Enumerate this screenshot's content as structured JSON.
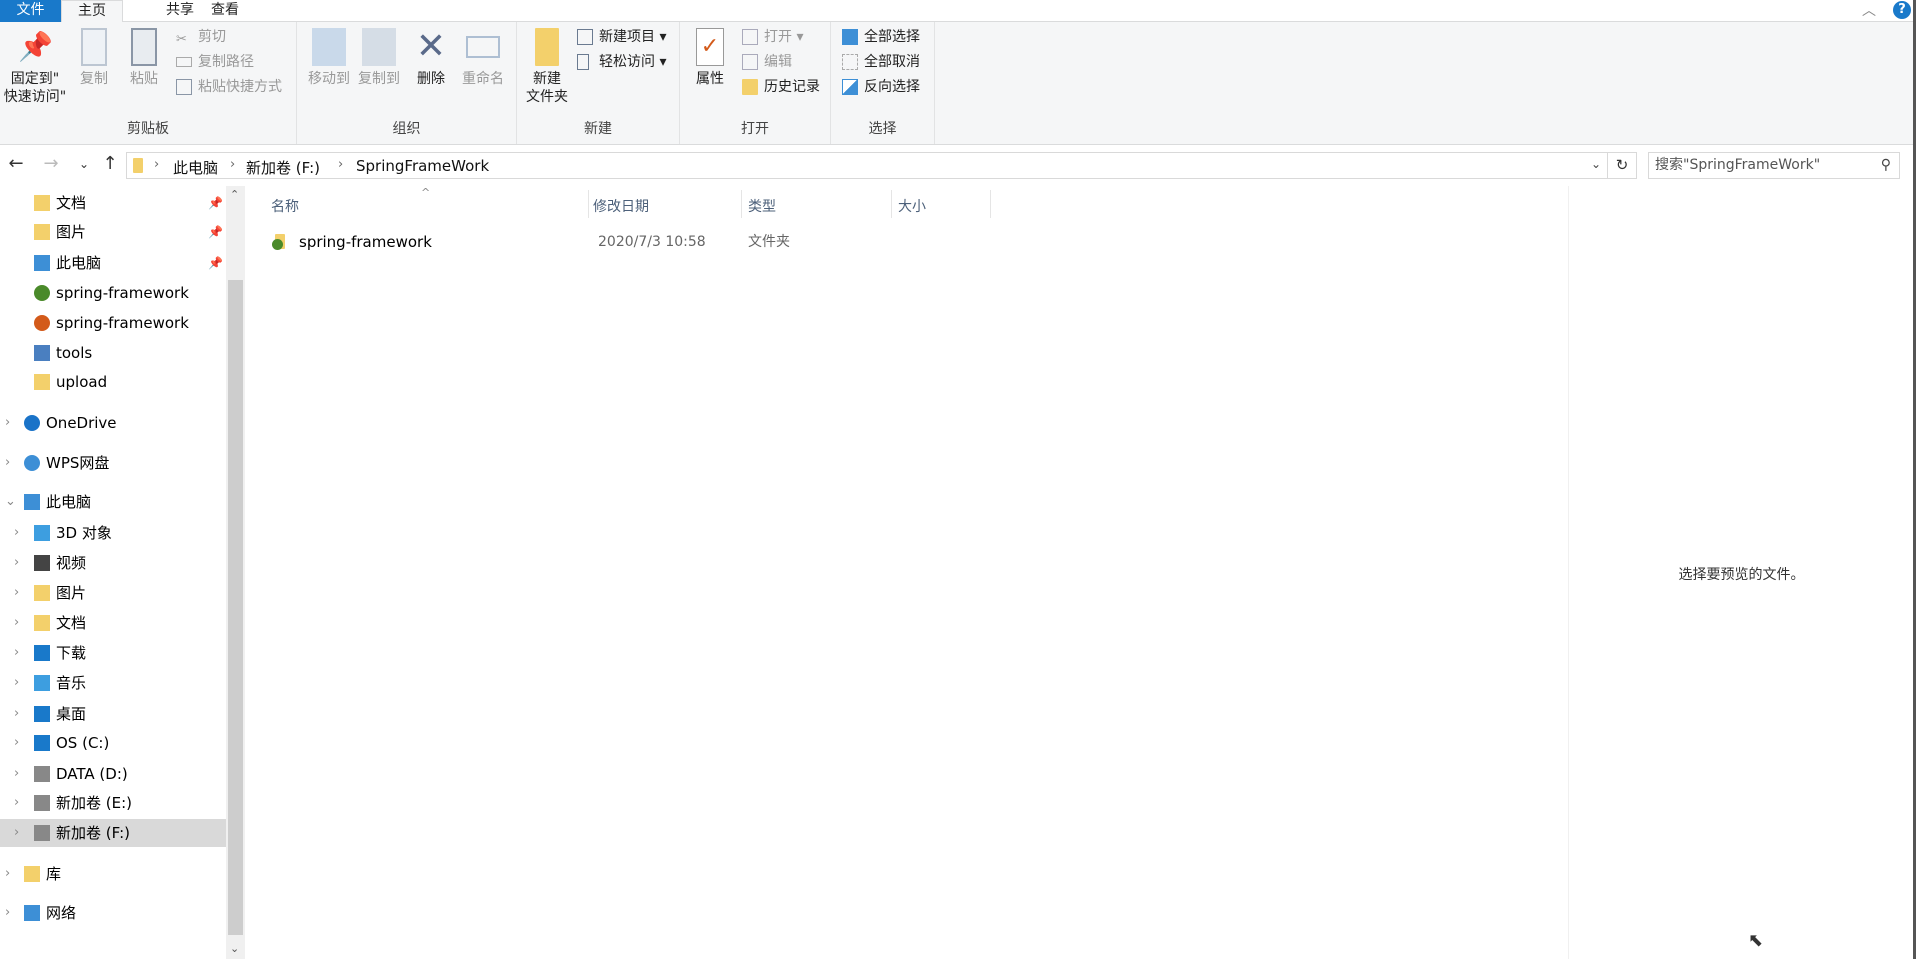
{
  "tabs": {
    "file": "文件",
    "home": "主页",
    "share": "共享",
    "view": "查看"
  },
  "ribbon": {
    "clipboard": {
      "label": "剪贴板",
      "pin": "固定到\"快速访问\"",
      "pin_l1": "固定到\"",
      "pin_l2": "快速访问\"",
      "copy": "复制",
      "paste": "粘贴",
      "cut": "剪切",
      "copy_path": "复制路径",
      "paste_shortcut": "粘贴快捷方式"
    },
    "organize": {
      "label": "组织",
      "move_to": "移动到",
      "copy_to": "复制到",
      "delete": "删除",
      "rename": "重命名"
    },
    "new": {
      "label": "新建",
      "new_folder_l1": "新建",
      "new_folder_l2": "文件夹",
      "new_item": "新建项目",
      "easy_access": "轻松访问"
    },
    "open": {
      "label": "打开",
      "properties": "属性",
      "open": "打开",
      "edit": "编辑",
      "history": "历史记录"
    },
    "select": {
      "label": "选择",
      "select_all": "全部选择",
      "select_none": "全部取消",
      "invert": "反向选择"
    }
  },
  "address": {
    "crumbs": [
      "此电脑",
      "新加卷 (F:)",
      "SpringFrameWork"
    ],
    "search_placeholder": "搜索\"SpringFrameWork\""
  },
  "sidebar": {
    "items": [
      {
        "label": "文档",
        "icon": "documents-icon",
        "pinned": true
      },
      {
        "label": "图片",
        "icon": "pictures-icon",
        "pinned": true
      },
      {
        "label": "此电脑",
        "icon": "computer-icon",
        "pinned": true
      },
      {
        "label": "spring-framework",
        "icon": "git-clean-folder-icon"
      },
      {
        "label": "spring-framework",
        "icon": "git-modified-folder-icon"
      },
      {
        "label": "tools",
        "icon": "network-folder-icon"
      },
      {
        "label": "upload",
        "icon": "folder-icon"
      },
      {
        "label": "OneDrive",
        "icon": "onedrive-icon"
      },
      {
        "label": "WPS网盘",
        "icon": "cloud-icon"
      },
      {
        "label": "此电脑",
        "icon": "computer-icon",
        "expanded": true
      },
      {
        "label": "3D 对象",
        "icon": "3d-objects-icon"
      },
      {
        "label": "视频",
        "icon": "videos-icon"
      },
      {
        "label": "图片",
        "icon": "pictures-icon"
      },
      {
        "label": "文档",
        "icon": "documents-icon"
      },
      {
        "label": "下载",
        "icon": "downloads-icon"
      },
      {
        "label": "音乐",
        "icon": "music-icon"
      },
      {
        "label": "桌面",
        "icon": "desktop-icon"
      },
      {
        "label": "OS (C:)",
        "icon": "windows-drive-icon"
      },
      {
        "label": "DATA (D:)",
        "icon": "drive-icon"
      },
      {
        "label": "新加卷 (E:)",
        "icon": "drive-icon"
      },
      {
        "label": "新加卷 (F:)",
        "icon": "drive-icon",
        "selected": true
      },
      {
        "label": "库",
        "icon": "library-icon"
      },
      {
        "label": "网络",
        "icon": "network-icon"
      }
    ]
  },
  "columns": {
    "name": "名称",
    "modified": "修改日期",
    "type": "类型",
    "size": "大小"
  },
  "files": [
    {
      "name": "spring-framework",
      "modified": "2020/7/3 10:58",
      "type": "文件夹",
      "size": ""
    }
  ],
  "preview": {
    "empty_text": "选择要预览的文件。"
  },
  "colors": {
    "accent": "#1979ca",
    "selected": "#d9d9d9",
    "ribbon_bg": "#f5f6f7"
  }
}
